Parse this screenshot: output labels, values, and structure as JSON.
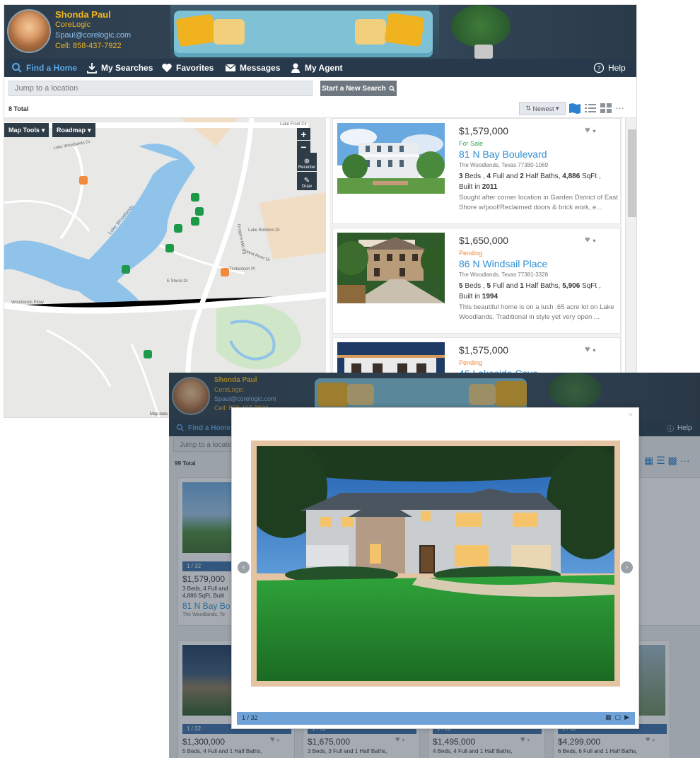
{
  "top_app": {
    "agent": {
      "name": "Shonda Paul",
      "company": "CoreLogic",
      "email": "Spaul@corelogic.com",
      "phone": "Cell: 858-437-7922"
    },
    "nav": {
      "find": "Find a Home",
      "searches": "My Searches",
      "favorites": "Favorites",
      "messages": "Messages",
      "agent": "My Agent",
      "help": "Help"
    },
    "search": {
      "placeholder": "Jump to a location",
      "button": "Start a New Search"
    },
    "toolbar": {
      "total": "8 Total",
      "sort": "Newest"
    },
    "map": {
      "tools": "Map Tools",
      "type": "Roadmap",
      "zoom_in": "+",
      "zoom_out": "−",
      "recenter": "Recenter",
      "draw": "Draw",
      "credit": "Map data",
      "labels": [
        "Lake Front Cir",
        "Lake Woodlands Dr",
        "Lake Woodlands",
        "Lake Robbins Dr",
        "Woodlands Pkwy",
        "E Shore Dr",
        "Grogans Mill Rd",
        "Timberloch Pl",
        "Wind River Dr"
      ]
    },
    "listings": [
      {
        "price": "$1,579,000",
        "status": "For Sale",
        "status_color": "#3aa657",
        "address": "81 N Bay Boulevard",
        "city": "The Woodlands, Texas 77380-1069",
        "beds": "3",
        "full": "4",
        "half": "2",
        "sqft": "4,886",
        "built": "2011",
        "desc": "Sought after corner location in Garden District of East Shore w/pool!Reclaimed doors & brick work, e..."
      },
      {
        "price": "$1,650,000",
        "status": "Pending",
        "status_color": "#f08a3c",
        "address": "86 N Windsail Place",
        "city": "The Woodlands, Texas 77381-3328",
        "beds": "5",
        "full": "5",
        "half": "1",
        "sqft": "5,906",
        "built": "1994",
        "desc": "This beautiful home is on a lush .65 acre lot on Lake Woodlands. Traditional in style yet very open ..."
      },
      {
        "price": "$1,575,000",
        "status": "Pending",
        "status_color": "#f08a3c",
        "address": "46 Lakeside Cove"
      }
    ],
    "spec_words": {
      "beds": "Beds ,",
      "full": "Full and",
      "half": "Half Baths,",
      "sqft": "SqFt ,",
      "built": "Built in"
    }
  },
  "bottom_app": {
    "agent": {
      "name": "Shonda Paul",
      "company": "CoreLogic",
      "email": "Spaul@corelogic.com",
      "phone": "Cell: 858-437-7922"
    },
    "nav": {
      "find": "Find a Home",
      "help": "Help"
    },
    "search": {
      "placeholder": "Jump to a location"
    },
    "total": "99 Total",
    "grid": [
      {
        "count": "1 / 32",
        "price": "$1,579,000",
        "specs1": "3 Beds, 4 Full and",
        "specs2": "4,886 SqFt, Built",
        "address": "81 N Bay Bo",
        "city": "The Woodlands, Te"
      },
      {
        "count": "1 / 32",
        "price": "$1,300,000",
        "specs1": "5 Beds, 4 Full and 1 Half Baths,"
      },
      {
        "count": "1 / 32",
        "price": "$1,675,000",
        "specs1": "3 Beds, 3 Full and 1 Half Baths,"
      },
      {
        "count": "1 / 32",
        "price": "$1,495,000",
        "specs1": "4 Beds, 4 Full and 1 Half Baths,"
      },
      {
        "count": "1 / 32",
        "price": "$4,299,000",
        "specs1": "6 Beds, 6 Full and 1 Half Baths,"
      }
    ],
    "modal": {
      "counter": "1 / 32",
      "close": "×"
    }
  }
}
